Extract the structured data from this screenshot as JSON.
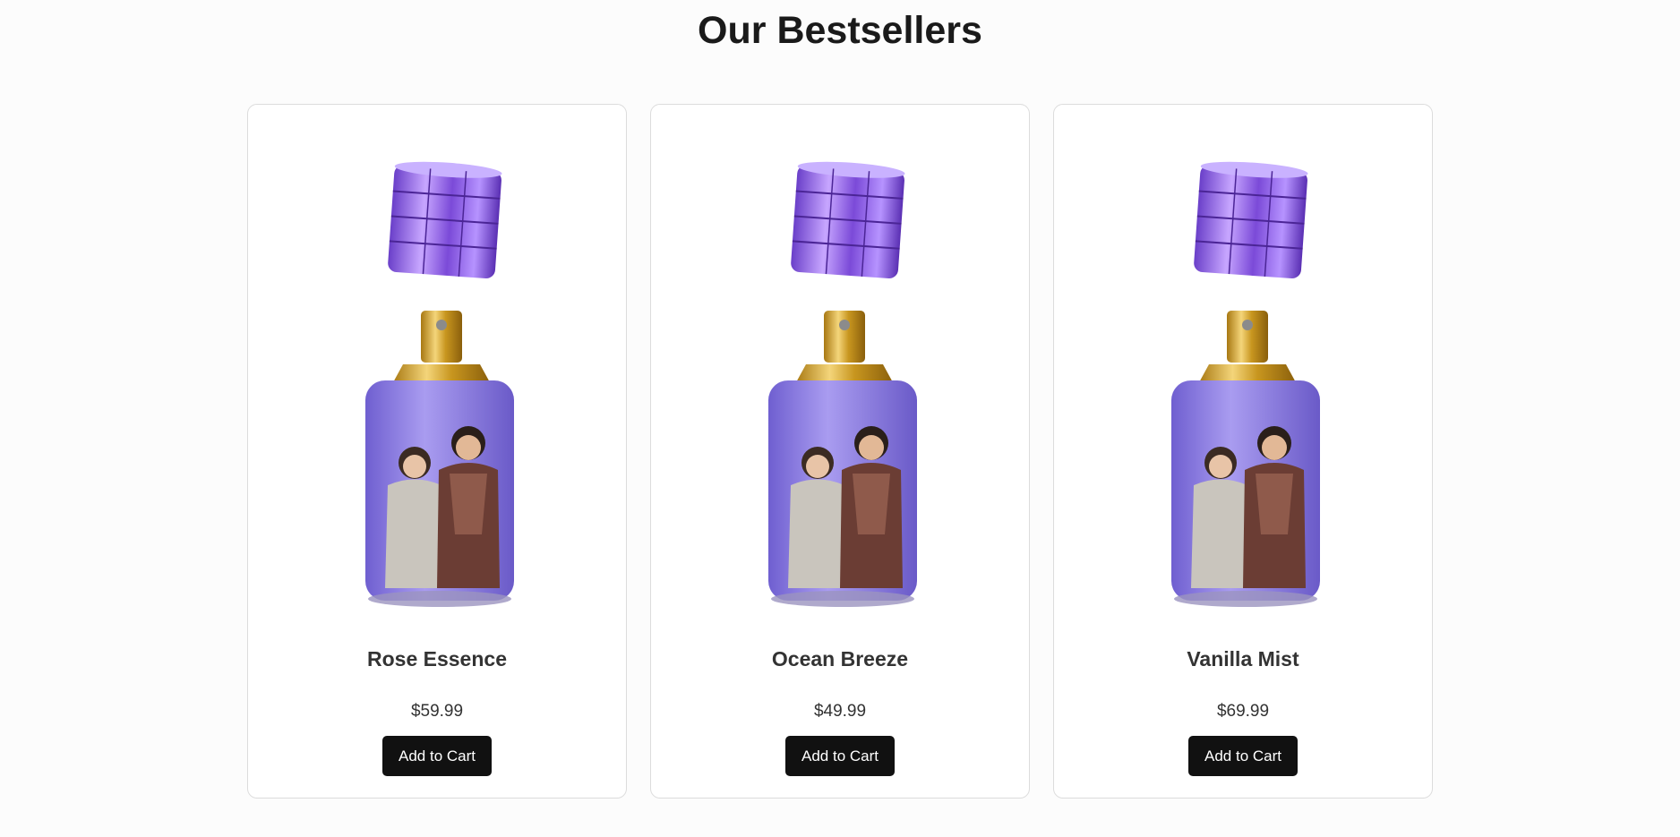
{
  "section": {
    "title": "Our Bestsellers"
  },
  "products": [
    {
      "name": "Rose Essence",
      "price": "$59.99",
      "button_label": "Add to Cart"
    },
    {
      "name": "Ocean Breeze",
      "price": "$49.99",
      "button_label": "Add to Cart"
    },
    {
      "name": "Vanilla Mist",
      "price": "$69.99",
      "button_label": "Add to Cart"
    }
  ],
  "colors": {
    "bottle_glass": "#8f7fe0",
    "cap_purple": "#9a6fe6",
    "nozzle_gold": "#d6a934",
    "button_bg": "#111111"
  },
  "icons": {
    "product_image": "perfume-bottle-image"
  }
}
